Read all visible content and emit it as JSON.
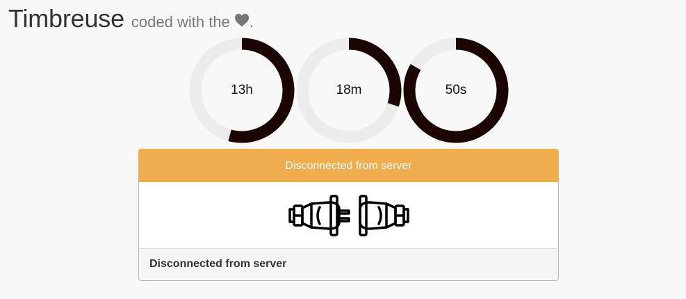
{
  "header": {
    "title": "Timbreuse",
    "tagline": "coded with the",
    "tagline_end": ".",
    "heart_icon": "heart-icon"
  },
  "timers": [
    {
      "id": "hours",
      "label": "13h",
      "value": 13,
      "max": 24
    },
    {
      "id": "minutes",
      "label": "18m",
      "value": 18,
      "max": 60
    },
    {
      "id": "seconds",
      "label": "50s",
      "value": 50,
      "max": 60
    }
  ],
  "colors": {
    "ring_track": "#ececec",
    "ring_fill": "#1a0500",
    "panel_heading": "#f0ad4e",
    "panel_border": "#efae4e"
  },
  "panel": {
    "heading": "Disconnected from server",
    "icon": "unplugged-icon",
    "footer": "Disconnected from server"
  }
}
